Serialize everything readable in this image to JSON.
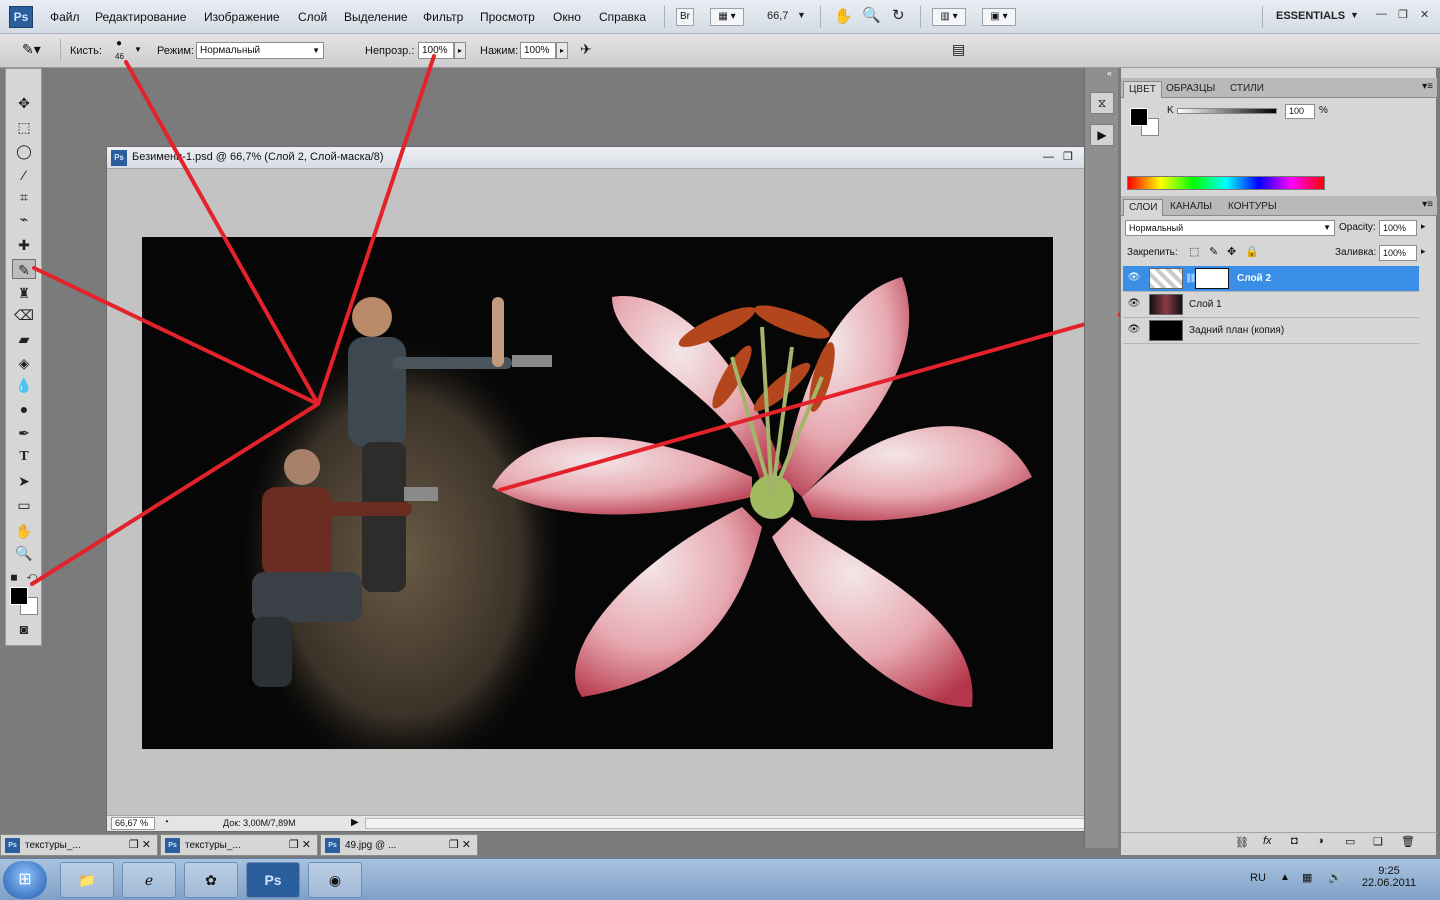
{
  "app": {
    "logo": "Ps"
  },
  "menubar": {
    "items": [
      "Файл",
      "Редактирование",
      "Изображение",
      "Слой",
      "Выделение",
      "Фильтр",
      "Просмотр",
      "Окно",
      "Справка"
    ],
    "bridge_button": "Br",
    "zoom": "66,7",
    "workspace": "ESSENTIALS"
  },
  "options": {
    "brush_label": "Кисть:",
    "brush_size": "46",
    "mode_label": "Режим:",
    "mode_value": "Нормальный",
    "opacity_label": "Непрозр.:",
    "opacity_value": "100%",
    "pressure_label": "Нажим:",
    "pressure_value": "100%"
  },
  "tools": [
    "move-tool",
    "marquee-tool",
    "lasso-tool",
    "magic-wand-tool",
    "crop-tool",
    "eyedropper-tool",
    "healing-tool",
    "brush-tool",
    "stamp-tool",
    "history-brush-tool",
    "eraser-tool",
    "paint-bucket-tool",
    "blur-tool",
    "dodge-tool",
    "pen-tool",
    "type-tool",
    "path-select-tool",
    "shape-tool",
    "hand-tool",
    "zoom-tool"
  ],
  "document": {
    "title": "Безимени-1.psd @ 66,7% (Слой 2, Слой-маска/8)",
    "zoom": "66,67 %",
    "doc_size": "Док: 3,00M/7,89M"
  },
  "color_panel": {
    "tabs": [
      "ЦВЕТ",
      "ОБРАЗЦЫ",
      "СТИЛИ"
    ],
    "channel_label": "K",
    "value": "100",
    "unit": "%"
  },
  "layers_panel": {
    "tabs": [
      "СЛОИ",
      "КАНАЛЫ",
      "КОНТУРЫ"
    ],
    "blend_mode": "Нормальный",
    "opacity_label": "Opacity:",
    "opacity_value": "100%",
    "lock_label": "Закрепить:",
    "fill_label": "Заливка:",
    "fill_value": "100%",
    "layers": [
      {
        "name": "Слой 2",
        "selected": true
      },
      {
        "name": "Слой 1",
        "selected": false
      },
      {
        "name": "Задний план (копия)",
        "selected": false
      }
    ]
  },
  "mini_windows": [
    {
      "title": "текстуры_..."
    },
    {
      "title": "текстуры_..."
    },
    {
      "title": "49.jpg @ ..."
    }
  ],
  "taskbar": {
    "apps": [
      "explorer-icon",
      "ie-icon",
      "icq-icon",
      "photoshop-icon",
      "firefox-icon"
    ],
    "lang": "RU",
    "time": "9:25",
    "date": "22.06.2011"
  },
  "colors": {
    "selection_blue": "#3a8ee6",
    "annotation_red": "#e3222b"
  }
}
